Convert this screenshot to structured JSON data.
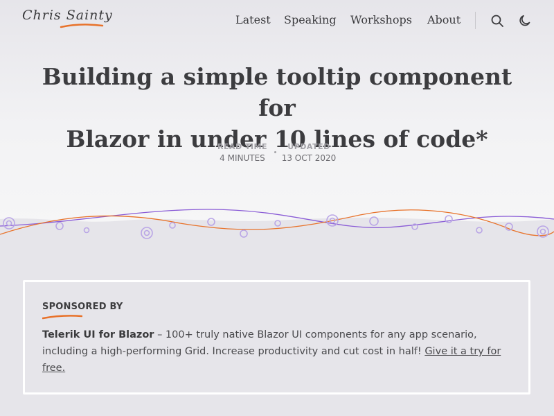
{
  "site": {
    "logo_text": "Chris Sainty"
  },
  "nav": {
    "items": [
      {
        "label": "Latest"
      },
      {
        "label": "Speaking"
      },
      {
        "label": "Workshops"
      },
      {
        "label": "About"
      }
    ],
    "icons": [
      "search-icon",
      "moon-icon"
    ]
  },
  "article": {
    "title_line1": "Building a simple tooltip component for",
    "title_line2": "Blazor in under 10 lines of code*",
    "read_time_label": "READ TIME",
    "read_time_value": "4 MINUTES",
    "updated_label": "UPDATED",
    "updated_value": "13 OCT 2020"
  },
  "sponsor": {
    "heading": "SPONSORED BY",
    "brand": "Telerik UI for Blazor",
    "body": " – 100+ truly native Blazor UI components for any app scenario, including a high-performing Grid. Increase productivity and cut cost in half! ",
    "link_text": "Give it a try for free."
  },
  "colors": {
    "background": "#e6e5ea",
    "accent_orange": "#e8722a",
    "accent_purple": "#8a5cd6",
    "text": "#3d3d3f"
  }
}
